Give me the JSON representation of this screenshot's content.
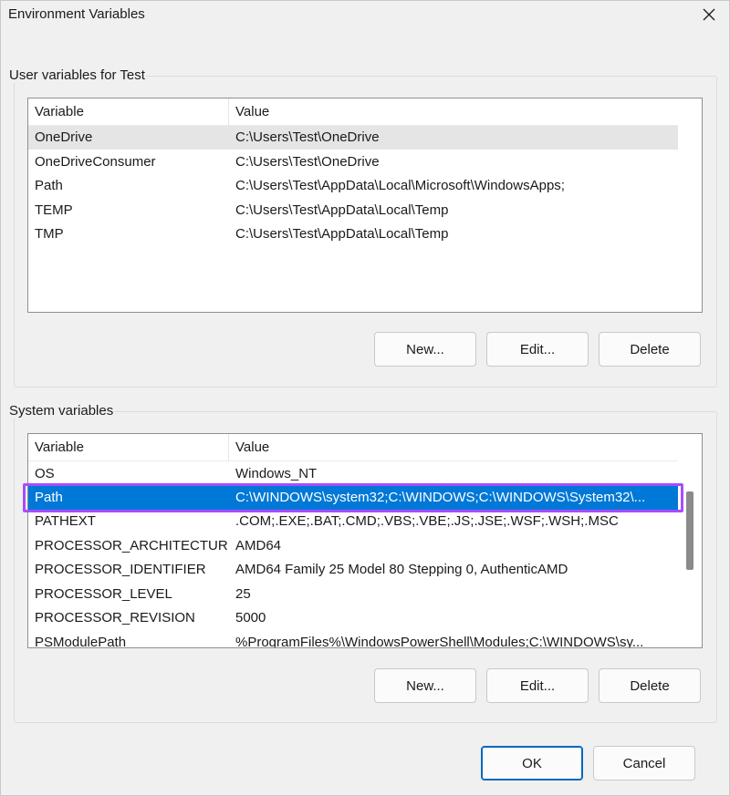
{
  "window": {
    "title": "Environment Variables"
  },
  "user_section": {
    "label": "User variables for Test",
    "columns": {
      "variable": "Variable",
      "value": "Value"
    },
    "rows": [
      {
        "variable": "OneDrive",
        "value": "C:\\Users\\Test\\OneDrive"
      },
      {
        "variable": "OneDriveConsumer",
        "value": "C:\\Users\\Test\\OneDrive"
      },
      {
        "variable": "Path",
        "value": "C:\\Users\\Test\\AppData\\Local\\Microsoft\\WindowsApps;"
      },
      {
        "variable": "TEMP",
        "value": "C:\\Users\\Test\\AppData\\Local\\Temp"
      },
      {
        "variable": "TMP",
        "value": "C:\\Users\\Test\\AppData\\Local\\Temp"
      }
    ],
    "buttons": {
      "new": "New...",
      "edit": "Edit...",
      "delete": "Delete"
    }
  },
  "system_section": {
    "label": "System variables",
    "columns": {
      "variable": "Variable",
      "value": "Value"
    },
    "selected_row": "Path",
    "rows": [
      {
        "variable": "OS",
        "value": "Windows_NT"
      },
      {
        "variable": "Path",
        "value": "C:\\WINDOWS\\system32;C:\\WINDOWS;C:\\WINDOWS\\System32\\..."
      },
      {
        "variable": "PATHEXT",
        "value": ".COM;.EXE;.BAT;.CMD;.VBS;.VBE;.JS;.JSE;.WSF;.WSH;.MSC"
      },
      {
        "variable": "PROCESSOR_ARCHITECTURE",
        "value": "AMD64"
      },
      {
        "variable": "PROCESSOR_IDENTIFIER",
        "value": "AMD64 Family 25 Model 80 Stepping 0, AuthenticAMD"
      },
      {
        "variable": "PROCESSOR_LEVEL",
        "value": "25"
      },
      {
        "variable": "PROCESSOR_REVISION",
        "value": "5000"
      },
      {
        "variable": "PSModulePath",
        "value": "%ProgramFiles%\\WindowsPowerShell\\Modules;C:\\WINDOWS\\sy..."
      }
    ],
    "buttons": {
      "new": "New...",
      "edit": "Edit...",
      "delete": "Delete"
    }
  },
  "footer": {
    "ok": "OK",
    "cancel": "Cancel"
  },
  "colors": {
    "selection": "#0078d7",
    "highlight_outline": "#a64dff",
    "hover_row": "#e5e5e5"
  },
  "icons": {
    "close": "close-icon"
  }
}
